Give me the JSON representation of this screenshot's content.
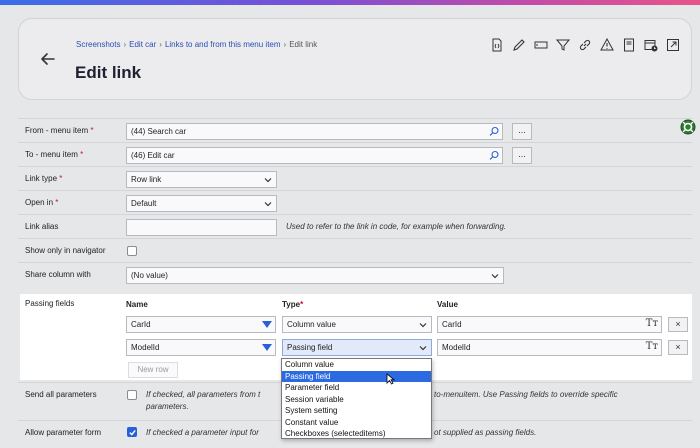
{
  "header": {
    "breadcrumb": [
      "Screenshots",
      "Edit car",
      "Links to and from this menu item",
      "Edit link"
    ],
    "title": "Edit link",
    "toolbar_icons": [
      "code-file-icon",
      "pencil-icon",
      "text-field-icon",
      "filter-icon",
      "link-icon",
      "warning-icon",
      "book-icon",
      "calendar-clock-icon",
      "external-link-icon"
    ]
  },
  "form": {
    "from_label": "From - menu item",
    "from_value": "(44) Search car",
    "to_label": "To - menu item",
    "to_value": "(46) Edit car",
    "link_type_label": "Link type",
    "link_type_value": "Row link",
    "open_in_label": "Open in",
    "open_in_value": "Default",
    "alias_label": "Link alias",
    "alias_value": "",
    "alias_hint": "Used to refer to the link in code, for example when forwarding.",
    "navigator_label": "Show only in navigator",
    "navigator_checked": false,
    "share_label": "Share column with",
    "share_value": "(No value)",
    "dots": "...",
    "required_mark": "*"
  },
  "passing_fields": {
    "label": "Passing fields",
    "col_name": "Name",
    "col_type": "Type",
    "col_type_req": "*",
    "col_value": "Value",
    "rows": [
      {
        "name": "CarId",
        "type": "Column value",
        "value": "CarId"
      },
      {
        "name": "ModelId",
        "type": "Passing field",
        "value": "ModelId"
      }
    ],
    "remove_label": "×",
    "new_row_label": "New row",
    "tt_label": "Tт"
  },
  "type_dropdown": {
    "options": [
      "Column value",
      "Passing field",
      "Parameter field",
      "Session variable",
      "System setting",
      "Constant value",
      "Checkboxes (selecteditems)"
    ],
    "selected_index": 1
  },
  "send_all": {
    "label": "Send all parameters",
    "checked": false,
    "hint_part1": "If checked, all parameters from t",
    "hint_part2": "to-menuitem. Use Passing fields to override specific",
    "hint_line2": "parameters."
  },
  "allow_form": {
    "label": "Allow parameter form",
    "checked": true,
    "hint_part1": "If checked a parameter input for",
    "hint_part2": "ot supplied as passing fields."
  },
  "colors": {
    "accent": "#2b5fd6",
    "selection": "#2b6ae0",
    "link": "#2b4db0",
    "required": "#c8102e"
  }
}
